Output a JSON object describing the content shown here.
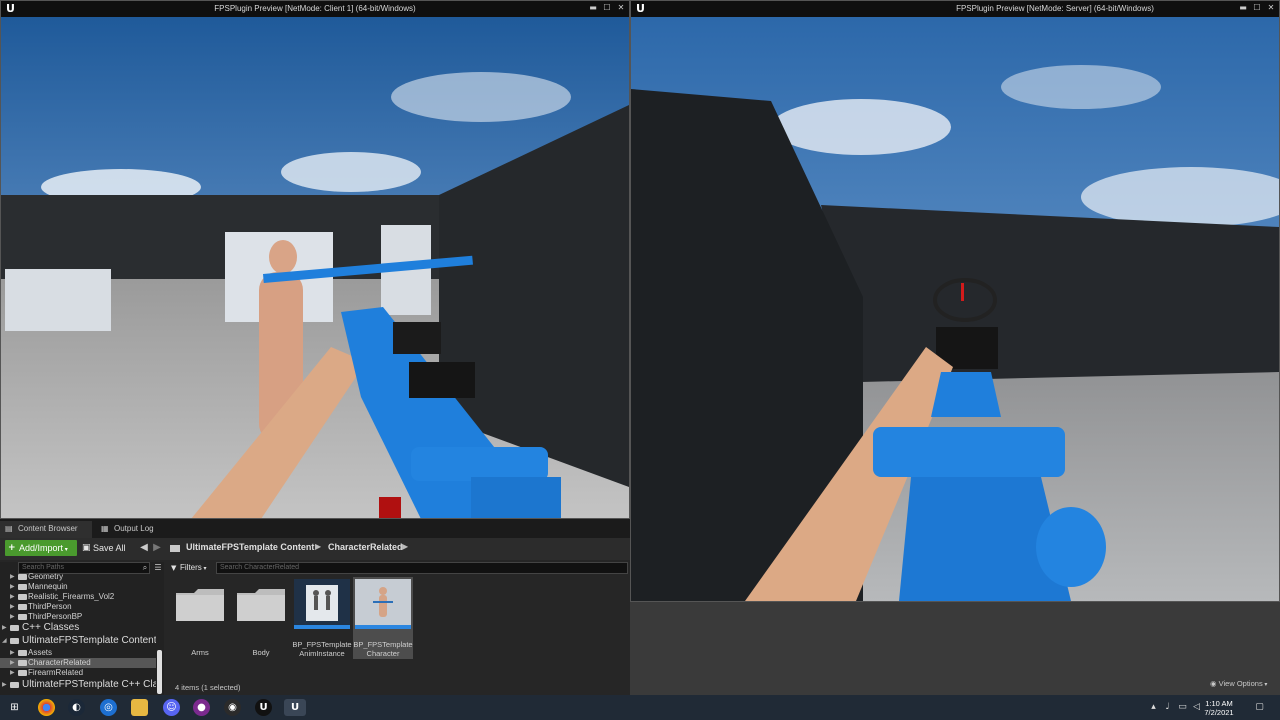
{
  "windows": {
    "client": {
      "title": "FPSPlugin Preview [NetMode: Client 1]  (64-bit/Windows)",
      "logo": "U"
    },
    "server": {
      "title": "FPSPlugin Preview [NetMode: Server]  (64-bit/Windows)",
      "logo": "U"
    },
    "controls": {
      "minimize": "▬",
      "maximize": "☐",
      "close": "✕"
    }
  },
  "content_browser": {
    "tabs": [
      {
        "label": "Content Browser",
        "icon": "content-browser-icon"
      },
      {
        "label": "Output Log",
        "icon": "output-log-icon"
      }
    ],
    "toolbar": {
      "add_import": "Add/Import",
      "save_all": "Save All",
      "breadcrumb": [
        "UltimateFPSTemplate Content",
        "CharacterRelated"
      ]
    },
    "search_paths_placeholder": "Search Paths",
    "search_assets_placeholder": "Search CharacterRelated",
    "filters_label": "Filters",
    "tree": [
      {
        "label": "Geometry",
        "level": 1
      },
      {
        "label": "Mannequin",
        "level": 1
      },
      {
        "label": "Realistic_Firearms_Vol2",
        "level": 1
      },
      {
        "label": "ThirdPerson",
        "level": 1
      },
      {
        "label": "ThirdPersonBP",
        "level": 1
      },
      {
        "label": "C++ Classes",
        "level": 0
      },
      {
        "label": "UltimateFPSTemplate Content",
        "level": 0
      },
      {
        "label": "Assets",
        "level": 1
      },
      {
        "label": "CharacterRelated",
        "level": 1,
        "selected": true
      },
      {
        "label": "FirearmRelated",
        "level": 1
      },
      {
        "label": "UltimateFPSTemplate C++ Cla",
        "level": 0
      }
    ],
    "assets": [
      {
        "label": "Arms",
        "type": "folder"
      },
      {
        "label": "Body",
        "type": "folder"
      },
      {
        "label": "BP_FPSTemplate AnimInstance",
        "line1": "BP_FPSTemplate",
        "line2": "AnimInstance",
        "type": "anim-blueprint"
      },
      {
        "label": "BP_FPSTemplate Character",
        "line1": "BP_FPSTemplate",
        "line2": "Character",
        "type": "character-blueprint"
      }
    ],
    "items_count": "4 items (1 selected)",
    "view_options": "View Options"
  },
  "taskbar": {
    "apps": [
      "start-icon",
      "chrome-icon",
      "steam-icon",
      "uplay-icon",
      "file-explorer-icon",
      "discord-icon",
      "app-icon",
      "obs-icon",
      "unreal-icon",
      "unreal-icon"
    ],
    "time": "1:10 AM",
    "date": "7/2/2021"
  },
  "colors": {
    "accent_green": "#4a9a2e",
    "weapon_blue": "#1f7fdc",
    "taskbar": "#202a36"
  }
}
